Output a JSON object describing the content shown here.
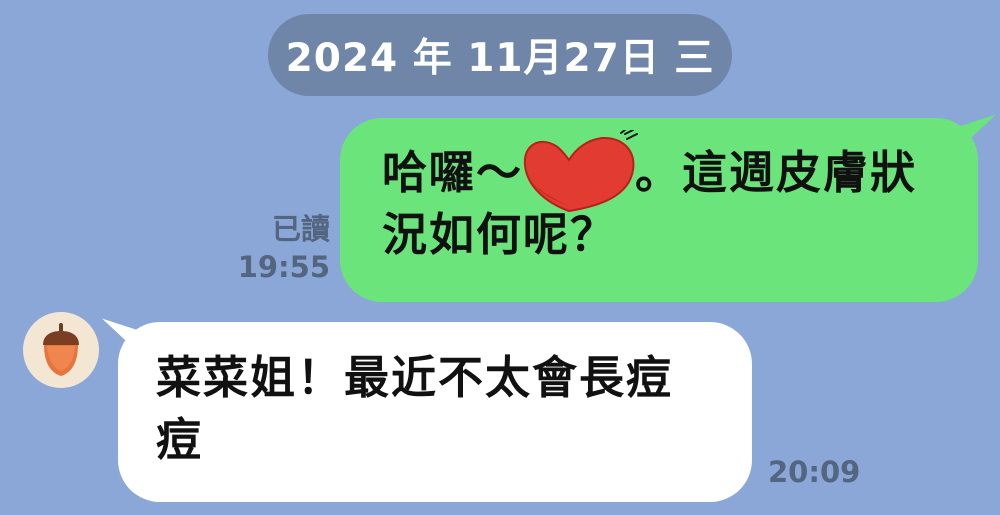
{
  "date": "2024 年 11月27日 三",
  "outgoing_message": {
    "text_before": "哈囉～",
    "sticker_icon": "red-heart-icon",
    "text_after": "。這週皮膚狀況如何呢？",
    "read_label": "已讀",
    "time": "19:55"
  },
  "incoming_message": {
    "sender_avatar_icon": "acorn-icon",
    "text": "菜菜姐！最近不太會長痘痘",
    "time": "20:09"
  },
  "colors": {
    "background": "#8aa7d8",
    "date_pill": "#6f86a9",
    "outgoing_bubble": "#6be57b",
    "incoming_bubble": "#ffffff",
    "meta_text": "#53657f",
    "heart": "#e23b31"
  }
}
